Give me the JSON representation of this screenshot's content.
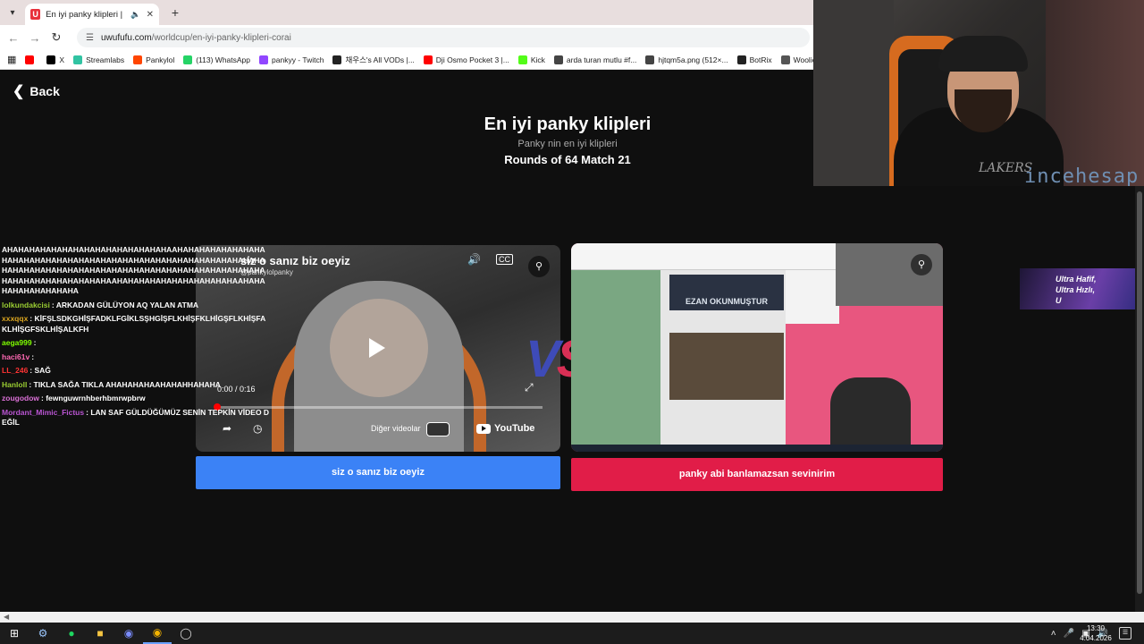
{
  "browser": {
    "tab_title": "En iyi panky klipleri | UwUFU",
    "url_host": "uwufufu.com",
    "url_path": "/worldcup/en-iyi-panky-klipleri-corai",
    "bookmarks": [
      {
        "label": "",
        "color": "#ff0000"
      },
      {
        "label": "X",
        "color": "#000000"
      },
      {
        "label": "Streamlabs",
        "color": "#31c3a2"
      },
      {
        "label": "Pankylol",
        "color": "#ff4500"
      },
      {
        "label": "(113) WhatsApp",
        "color": "#25d366"
      },
      {
        "label": "pankyy - Twitch",
        "color": "#9146ff"
      },
      {
        "label": "채우스's All VODs |...",
        "color": "#222222"
      },
      {
        "label": "Dji Osmo Pocket 3 |...",
        "color": "#ff0000"
      },
      {
        "label": "Kick",
        "color": "#53fc18"
      },
      {
        "label": "arda turan mutlu #f...",
        "color": "#444444"
      },
      {
        "label": "hjtqm5a.png (512×...",
        "color": "#444444"
      },
      {
        "label": "BotRix",
        "color": "#222222"
      },
      {
        "label": "Woolie",
        "color": "#555555"
      }
    ]
  },
  "webcam": {
    "overlay_text": "incehesap",
    "shirt_text": "LAKERS"
  },
  "page": {
    "back_label": "Back",
    "title": "En iyi panky klipleri",
    "subtitle": "Panky nin en iyi klipleri",
    "round_info": "Rounds of 64 Match 21",
    "vs_v": "V",
    "vs_s": "S"
  },
  "left_video": {
    "title": "siz o sanız biz oeyiz",
    "channel": "@pankylolpanky",
    "time": "0:00 / 0:16",
    "progress": 0.0,
    "more_videos": "Diğer videolar",
    "youtube_label": "YouTube",
    "cc": "CC"
  },
  "right_video": {
    "ezan_text": "EZAN OKUNMUŞTUR"
  },
  "choices": {
    "left": "siz o sanız biz oeyiz",
    "right": "panky abi banlamazsan sevinirim"
  },
  "chat": [
    {
      "user": "",
      "color": "#ffffff",
      "text": "AHAHAHAHAHAHAHAHAHAHAHAHAHAHAHAAHAHAHAHAHAHAHAHAHAHAHAHAHAHAHAHAHAHAHAHAHAHAHAHAHAHAHAHAHAHAHAHAHAHAHAHAHAHAHAHAHAHAHAHAHAHAHAHAHAHAHAHAHAHAHAHAHAHAHAHAHAHAHAHAHAHAAHAHAHAHAHAHAHAHAHAHAHAAHAHAHAHAHAHAHAHAHA"
    },
    {
      "user": "lolkundakcisi",
      "color": "#9acd32",
      "text": "ARKADAN GÜLÜYON AQ YALAN ATMA"
    },
    {
      "user": "xxxqqx",
      "color": "#daa520",
      "text": "KİFŞLSDKGHİŞFADKLFGİKLSŞHGİŞFLKHİŞFKLHİGŞFLKHİŞFAKLHİŞGFSKLHİŞALKFH"
    },
    {
      "user": "aega999",
      "color": "#7fff00",
      "text": ""
    },
    {
      "user": "haci61v",
      "color": "#ff69b4",
      "text": ""
    },
    {
      "user": "LL_246",
      "color": "#ff3333",
      "text": "SAĞ"
    },
    {
      "user": "Hanloll",
      "color": "#9acd32",
      "text": "TIKLA SAĞA TIKLA AHAHAHAHAAHAHAHHAHAHA"
    },
    {
      "user": "zougodow",
      "color": "#da70d6",
      "text": "fewnguwrnhberhbmrwpbrw"
    },
    {
      "user": "Mordant_Mimic_Fictus",
      "color": "#ba55d3",
      "text": "LAN SAF GÜLDÜĞÜMÜZ SENİN TEPKİN VİDEO DEĞİL"
    }
  ],
  "banner": {
    "line1": "Ultra Hafif,",
    "line2": "Ultra Hızlı,",
    "line3": "U"
  },
  "taskbar": {
    "time": "13:30",
    "date": "4.04.2026"
  }
}
